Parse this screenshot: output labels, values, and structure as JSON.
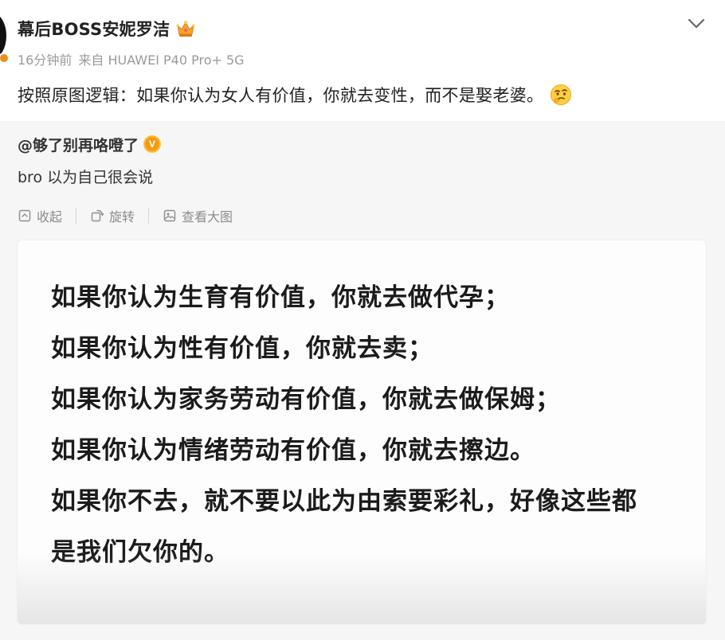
{
  "post": {
    "user_name": "幕后BOSS安妮罗洁",
    "time": "16分钟前",
    "source": "来自 HUAWEI P40 Pro+ 5G",
    "text": "按照原图逻辑：如果你认为女人有价值，你就去变性，而不是娶老婆。",
    "crown_icon": "crown-icon",
    "emoji_icon": "thinking-face-icon",
    "accent": "#f08a24"
  },
  "repost": {
    "user_name": "@够了别再咯噔了",
    "badge_label": "V",
    "badge_color": "#f79a13",
    "text": "bro 以为自己很会说",
    "actions": [
      {
        "label": "收起",
        "icon": "collapse-icon"
      },
      {
        "label": "旋转",
        "icon": "rotate-icon"
      },
      {
        "label": "查看大图",
        "icon": "view-image-icon"
      }
    ],
    "image": {
      "lines": [
        "如果你认为生育有价值，你就去做代孕；",
        "如果你认为性有价值，你就去卖；",
        "如果你认为家务劳动有价值，你就去做保姆；",
        "如果你认为情绪劳动有价值，你就去擦边。",
        "如果你不去，就不要以此为由索要彩礼，好像这些都",
        "是我们欠你的。"
      ]
    }
  }
}
